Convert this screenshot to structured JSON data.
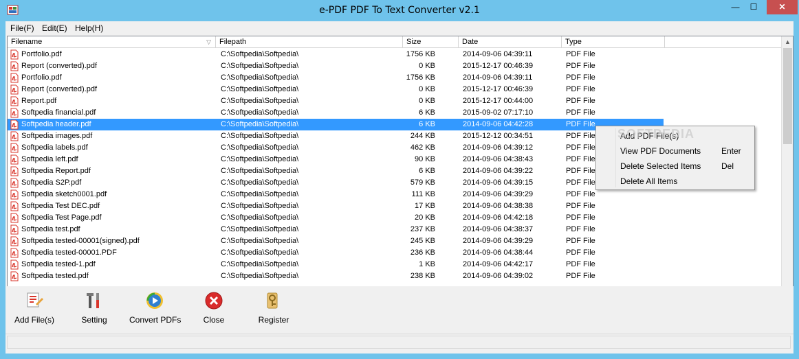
{
  "window": {
    "title": "e-PDF PDF To Text Converter v2.1",
    "minimize_glyph": "—",
    "maximize_glyph": "☐",
    "close_glyph": "✕"
  },
  "menu": {
    "items": [
      "File(F)",
      "Edit(E)",
      "Help(H)"
    ]
  },
  "table": {
    "columns": [
      "Filename",
      "Filepath",
      "Size",
      "Date",
      "Type"
    ],
    "rows": [
      {
        "name": "Portfolio.pdf",
        "path": "C:\\Softpedia\\Softpedia\\",
        "size": "1756 KB",
        "date": "2014-09-06 04:39:11",
        "type": "PDF File"
      },
      {
        "name": "Report (converted).pdf",
        "path": "C:\\Softpedia\\Softpedia\\",
        "size": "0 KB",
        "date": "2015-12-17 00:46:39",
        "type": "PDF File"
      },
      {
        "name": "Portfolio.pdf",
        "path": "C:\\Softpedia\\Softpedia\\",
        "size": "1756 KB",
        "date": "2014-09-06 04:39:11",
        "type": "PDF File"
      },
      {
        "name": "Report (converted).pdf",
        "path": "C:\\Softpedia\\Softpedia\\",
        "size": "0 KB",
        "date": "2015-12-17 00:46:39",
        "type": "PDF File"
      },
      {
        "name": "Report.pdf",
        "path": "C:\\Softpedia\\Softpedia\\",
        "size": "0 KB",
        "date": "2015-12-17 00:44:00",
        "type": "PDF File"
      },
      {
        "name": "Softpedia financial.pdf",
        "path": "C:\\Softpedia\\Softpedia\\",
        "size": "6 KB",
        "date": "2015-09-02 07:17:10",
        "type": "PDF File"
      },
      {
        "name": "Softpedia header.pdf",
        "path": "C:\\Softpedia\\Softpedia\\",
        "size": "6 KB",
        "date": "2014-09-06 04:42:28",
        "type": "PDF File",
        "selected": true
      },
      {
        "name": "Softpedia images.pdf",
        "path": "C:\\Softpedia\\Softpedia\\",
        "size": "244 KB",
        "date": "2015-12-12 00:34:51",
        "type": "PDF File"
      },
      {
        "name": "Softpedia labels.pdf",
        "path": "C:\\Softpedia\\Softpedia\\",
        "size": "462 KB",
        "date": "2014-09-06 04:39:12",
        "type": "PDF File"
      },
      {
        "name": "Softpedia left.pdf",
        "path": "C:\\Softpedia\\Softpedia\\",
        "size": "90 KB",
        "date": "2014-09-06 04:38:43",
        "type": "PDF File"
      },
      {
        "name": "Softpedia Report.pdf",
        "path": "C:\\Softpedia\\Softpedia\\",
        "size": "6 KB",
        "date": "2014-09-06 04:39:22",
        "type": "PDF File"
      },
      {
        "name": "Softpedia S2P.pdf",
        "path": "C:\\Softpedia\\Softpedia\\",
        "size": "579 KB",
        "date": "2014-09-06 04:39:15",
        "type": "PDF File"
      },
      {
        "name": "Softpedia sketch0001.pdf",
        "path": "C:\\Softpedia\\Softpedia\\",
        "size": "111 KB",
        "date": "2014-09-06 04:39:29",
        "type": "PDF File"
      },
      {
        "name": "Softpedia Test DEC.pdf",
        "path": "C:\\Softpedia\\Softpedia\\",
        "size": "17 KB",
        "date": "2014-09-06 04:38:38",
        "type": "PDF File"
      },
      {
        "name": "Softpedia Test Page.pdf",
        "path": "C:\\Softpedia\\Softpedia\\",
        "size": "20 KB",
        "date": "2014-09-06 04:42:18",
        "type": "PDF File"
      },
      {
        "name": "Softpedia test.pdf",
        "path": "C:\\Softpedia\\Softpedia\\",
        "size": "237 KB",
        "date": "2014-09-06 04:38:37",
        "type": "PDF File"
      },
      {
        "name": "Softpedia tested-00001(signed).pdf",
        "path": "C:\\Softpedia\\Softpedia\\",
        "size": "245 KB",
        "date": "2014-09-06 04:39:29",
        "type": "PDF File"
      },
      {
        "name": "Softpedia tested-00001.PDF",
        "path": "C:\\Softpedia\\Softpedia\\",
        "size": "236 KB",
        "date": "2014-09-06 04:38:44",
        "type": "PDF File"
      },
      {
        "name": "Softpedia tested-1.pdf",
        "path": "C:\\Softpedia\\Softpedia\\",
        "size": "1 KB",
        "date": "2014-09-06 04:42:17",
        "type": "PDF File"
      },
      {
        "name": "Softpedia tested.pdf",
        "path": "C:\\Softpedia\\Softpedia\\",
        "size": "238 KB",
        "date": "2014-09-06 04:39:02",
        "type": "PDF File"
      }
    ]
  },
  "context_menu": {
    "items": [
      {
        "label": "Add PDF File(s)",
        "shortcut": ""
      },
      {
        "label": "View PDF Documents",
        "shortcut": "Enter"
      },
      {
        "label": "Delete Selected Items",
        "shortcut": "Del"
      },
      {
        "label": "Delete All Items",
        "shortcut": ""
      }
    ]
  },
  "toolbar": {
    "add_files": "Add File(s)",
    "setting": "Setting",
    "convert": "Convert PDFs",
    "close": "Close",
    "register": "Register"
  },
  "watermark": "SOFTPEDIA",
  "colors": {
    "titlebar": "#6fc3eb",
    "selection": "#3399ff",
    "close_button": "#c75050",
    "pdf_icon": "#d9352b"
  }
}
